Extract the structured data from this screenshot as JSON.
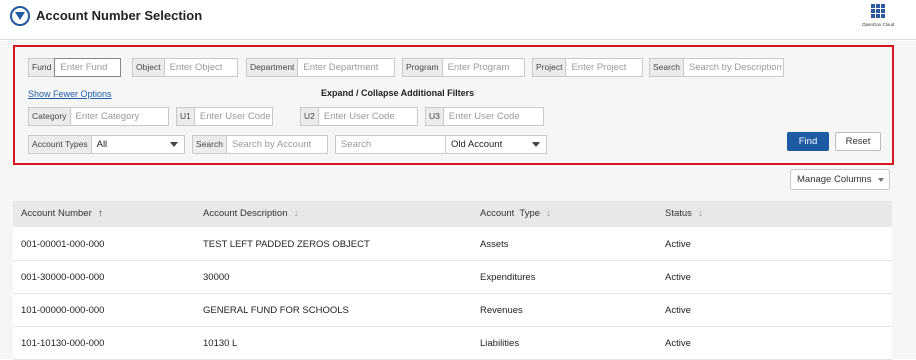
{
  "header": {
    "title": "Account Number Selection",
    "apps_label": "OpenGov Cloud"
  },
  "filters": {
    "row1": [
      {
        "label": "Fund",
        "placeholder": "Enter Fund"
      },
      {
        "label": "Object",
        "placeholder": "Enter Object"
      },
      {
        "label": "Department",
        "placeholder": "Enter Department"
      },
      {
        "label": "Program",
        "placeholder": "Enter Program"
      },
      {
        "label": "Project",
        "placeholder": "Enter Project"
      },
      {
        "label": "Search",
        "placeholder": "Search by Description"
      }
    ],
    "show_fewer": "Show Fewer Options",
    "expand_label": "Expand / Collapse Additional Filters",
    "row2": [
      {
        "label": "Category",
        "placeholder": "Enter Category"
      },
      {
        "label": "U1",
        "placeholder": "Enter User Code"
      },
      {
        "label": "U2",
        "placeholder": "Enter User Code"
      },
      {
        "label": "U3",
        "placeholder": "Enter User Code"
      }
    ],
    "account_types": {
      "label": "Account Types",
      "value": "All"
    },
    "search_account": {
      "label": "Search",
      "placeholder": "Search by Account"
    },
    "search_plain": {
      "placeholder": "Search"
    },
    "old_account": {
      "value": "Old Account"
    },
    "find": "Find",
    "reset": "Reset"
  },
  "manage_columns": "Manage Columns",
  "table": {
    "columns": [
      "Account Number",
      "Account Description",
      "Account  Type",
      "Status"
    ],
    "rows": [
      [
        "001-00001-000-000",
        "TEST LEFT PADDED ZEROS OBJECT",
        "Assets",
        "Active"
      ],
      [
        "001-30000-000-000",
        "30000",
        "Expenditures",
        "Active"
      ],
      [
        "101-00000-000-000",
        "GENERAL FUND FOR SCHOOLS",
        "Revenues",
        "Active"
      ],
      [
        "101-10130-000-000",
        "10130 L",
        "Liabilities",
        "Active"
      ]
    ]
  },
  "colors": {
    "brand_blue": "#1d5aa3",
    "highlight_red": "#d8141f"
  }
}
